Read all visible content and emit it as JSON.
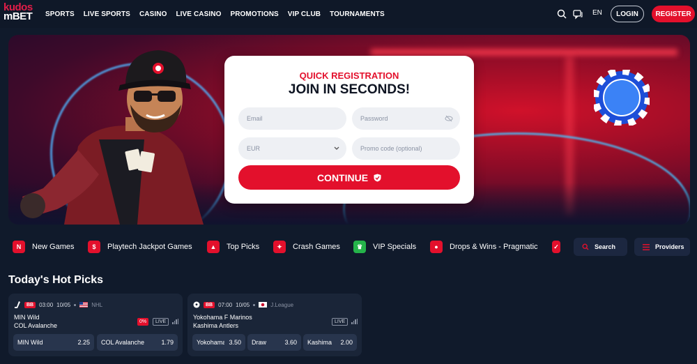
{
  "header": {
    "logo_top": "kudos",
    "logo_bottom": "BET",
    "nav": [
      "SPORTS",
      "LIVE SPORTS",
      "CASINO",
      "LIVE CASINO",
      "PROMOTIONS",
      "VIP CLUB",
      "TOURNAMENTS"
    ],
    "icons": [
      "search-icon",
      "chat-icon"
    ],
    "lang": "EN",
    "login": "LOGIN",
    "register": "REGISTER"
  },
  "registration": {
    "subtitle": "QUICK REGISTRATION",
    "title": "JOIN IN SECONDS!",
    "email_placeholder": "Email",
    "password_placeholder": "Password",
    "currency": "EUR",
    "promo_placeholder": "Promo code (optional)",
    "continue": "CONTINUE"
  },
  "categories": [
    {
      "label": "New Games",
      "icon": "new-icon",
      "color": "#e3102c"
    },
    {
      "label": "Playtech Jackpot Games",
      "icon": "jackpot-icon",
      "color": "#e3102c"
    },
    {
      "label": "Top Picks",
      "icon": "rocket-icon",
      "color": "#e3102c"
    },
    {
      "label": "Crash Games",
      "icon": "crash-icon",
      "color": "#e3102c"
    },
    {
      "label": "VIP Specials",
      "icon": "crown-icon",
      "color": "#25b34a"
    },
    {
      "label": "Drops & Wins - Pragmatic",
      "icon": "drops-icon",
      "color": "#e3102c"
    }
  ],
  "search_label": "Search",
  "providers_label": "Providers",
  "hot_picks": {
    "title": "Today's Hot Picks",
    "items": [
      {
        "badge": "BB",
        "time": "03:00",
        "date": "10/05",
        "league": "NHL",
        "home": "MIN Wild",
        "away": "COL Avalanche",
        "pct": "0%",
        "live": "LIVE",
        "odds": [
          {
            "name": "MIN Wild",
            "value": "2.25"
          },
          {
            "name": "COL Avalanche",
            "value": "1.79"
          }
        ]
      },
      {
        "badge": "BB",
        "time": "07:00",
        "date": "10/05",
        "league": "J.League",
        "home": "Yokohama F Marinos",
        "away": "Kashima Antlers",
        "live": "LIVE",
        "odds": [
          {
            "name": "Yokohama F Marinos",
            "value": "3.50"
          },
          {
            "name": "Draw",
            "value": "3.60"
          },
          {
            "name": "Kashima Antlers",
            "value": "2.00"
          }
        ]
      }
    ]
  },
  "colors": {
    "brand_red": "#e3102c",
    "bg": "#101a2b",
    "card": "#1a2538"
  }
}
